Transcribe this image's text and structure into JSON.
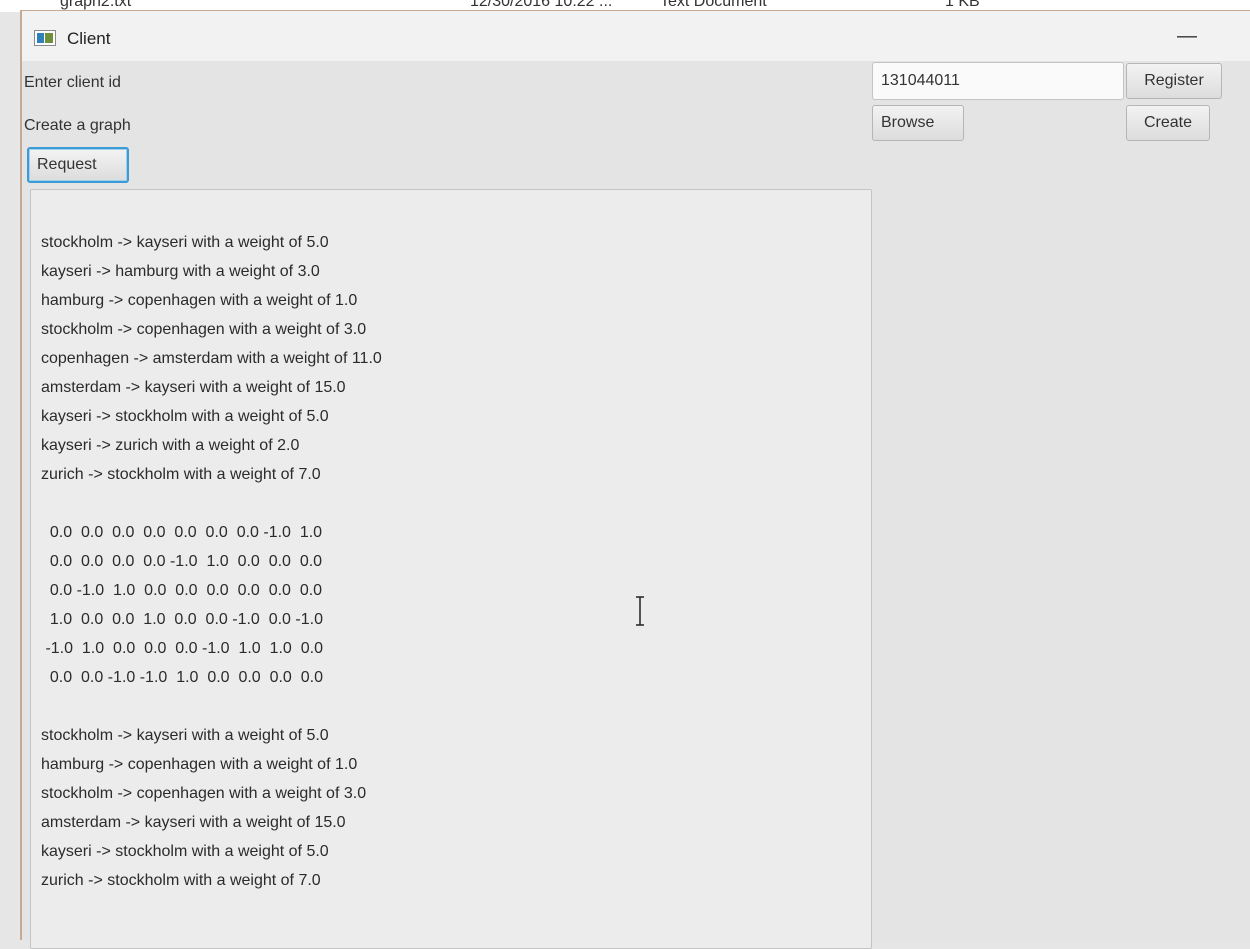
{
  "background": {
    "file_name": "graph2.txt",
    "file_date": "12/30/2016 10:22 ...",
    "file_type": "Text Document",
    "file_size": "1 KB"
  },
  "window": {
    "title": "Client",
    "minimize_glyph": "—",
    "icon": "app-window-icon"
  },
  "form": {
    "client_id_label": "Enter client id",
    "client_id_value": "131044011",
    "register_label": "Register",
    "graph_label": "Create a graph",
    "browse_label": "Browse",
    "create_label": "Create",
    "request_label": "Request"
  },
  "output": {
    "text": "stockholm -> kayseri with a weight of 5.0\nkayseri -> hamburg with a weight of 3.0\nhamburg -> copenhagen with a weight of 1.0\nstockholm -> copenhagen with a weight of 3.0\ncopenhagen -> amsterdam with a weight of 11.0\namsterdam -> kayseri with a weight of 15.0\nkayseri -> stockholm with a weight of 5.0\nkayseri -> zurich with a weight of 2.0\nzurich -> stockholm with a weight of 7.0\n\n  0.0  0.0  0.0  0.0  0.0  0.0  0.0 -1.0  1.0\n  0.0  0.0  0.0  0.0 -1.0  1.0  0.0  0.0  0.0\n  0.0 -1.0  1.0  0.0  0.0  0.0  0.0  0.0  0.0\n  1.0  0.0  0.0  1.0  0.0  0.0 -1.0  0.0 -1.0\n -1.0  1.0  0.0  0.0  0.0 -1.0  1.0  1.0  0.0\n  0.0  0.0 -1.0 -1.0  1.0  0.0  0.0  0.0  0.0\n\nstockholm -> kayseri with a weight of 5.0\nhamburg -> copenhagen with a weight of 1.0\nstockholm -> copenhagen with a weight of 3.0\namsterdam -> kayseri with a weight of 15.0\nkayseri -> stockholm with a weight of 5.0\nzurich -> stockholm with a weight of 7.0"
  },
  "cursor": {
    "icon": "text-cursor-icon"
  }
}
